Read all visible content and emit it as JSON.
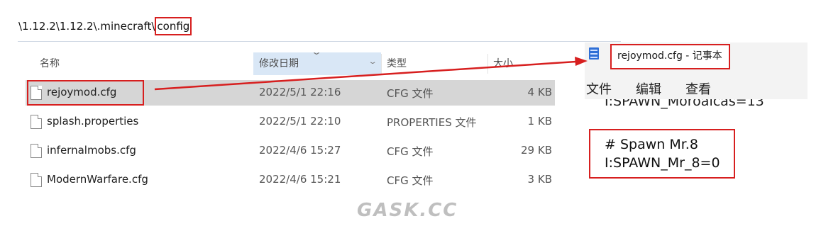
{
  "path": {
    "prefix": "\\1.12.2\\1.12.2\\.minecraft\\",
    "highlight": "config"
  },
  "columns": {
    "name": "名称",
    "date": "修改日期",
    "type": "类型",
    "size": "大小"
  },
  "files": [
    {
      "name": "rejoymod.cfg",
      "date": "2022/5/1 22:16",
      "type": "CFG 文件",
      "size": "4 KB",
      "selected": true
    },
    {
      "name": "splash.properties",
      "date": "2022/5/1 22:10",
      "type": "PROPERTIES 文件",
      "size": "1 KB",
      "selected": false
    },
    {
      "name": "infernalmobs.cfg",
      "date": "2022/4/6 15:27",
      "type": "CFG 文件",
      "size": "29 KB",
      "selected": false
    },
    {
      "name": "ModernWarfare.cfg",
      "date": "2022/4/6 15:21",
      "type": "CFG 文件",
      "size": "3 KB",
      "selected": false
    }
  ],
  "notepad": {
    "title": "rejoymod.cfg - 记事本",
    "menu": {
      "file": "文件",
      "edit": "编辑",
      "view": "查看"
    },
    "partial_line": "I:SPAWN_Moroaicas=13",
    "code_lines": [
      "# Spawn Mr.8",
      "I:SPAWN_Mr_8=0"
    ]
  },
  "watermark": "GASK.CC",
  "colors": {
    "highlight_red": "#d71f1f",
    "selection_gray": "#d6d6d6",
    "sorted_column": "#d9e7f6"
  }
}
